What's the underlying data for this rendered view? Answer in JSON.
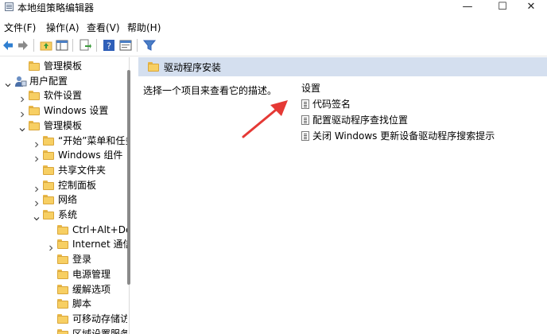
{
  "window": {
    "title": "本地组策略编辑器",
    "minimize": "—",
    "maximize": "☐",
    "close": "✕"
  },
  "menu": {
    "file": "文件(F)",
    "action": "操作(A)",
    "view": "查看(V)",
    "help": "帮助(H)"
  },
  "toolbar": {
    "buttons": [
      "back-icon",
      "forward-icon",
      "up-folder-icon",
      "show-hide-tree-icon",
      "export-list-icon",
      "help-icon",
      "properties-icon",
      "filter-icon"
    ]
  },
  "tree": {
    "items": [
      {
        "label": "管理模板",
        "depth": 1,
        "expanded": null,
        "icon": "folder"
      },
      {
        "label": "用户配置",
        "depth": 0,
        "expanded": true,
        "icon": "user"
      },
      {
        "label": "软件设置",
        "depth": 1,
        "expanded": false,
        "icon": "folder"
      },
      {
        "label": "Windows 设置",
        "depth": 1,
        "expanded": false,
        "icon": "folder"
      },
      {
        "label": "管理模板",
        "depth": 1,
        "expanded": true,
        "icon": "folder"
      },
      {
        "label": "“开始”菜单和任务",
        "depth": 2,
        "expanded": false,
        "icon": "folder"
      },
      {
        "label": "Windows 组件",
        "depth": 2,
        "expanded": false,
        "icon": "folder"
      },
      {
        "label": "共享文件夹",
        "depth": 2,
        "expanded": null,
        "icon": "folder"
      },
      {
        "label": "控制面板",
        "depth": 2,
        "expanded": false,
        "icon": "folder"
      },
      {
        "label": "网络",
        "depth": 2,
        "expanded": false,
        "icon": "folder"
      },
      {
        "label": "系统",
        "depth": 2,
        "expanded": true,
        "icon": "folder"
      },
      {
        "label": "Ctrl+Alt+De",
        "depth": 3,
        "expanded": null,
        "icon": "folder"
      },
      {
        "label": "Internet 通信",
        "depth": 3,
        "expanded": false,
        "icon": "folder"
      },
      {
        "label": "登录",
        "depth": 3,
        "expanded": null,
        "icon": "folder"
      },
      {
        "label": "电源管理",
        "depth": 3,
        "expanded": null,
        "icon": "folder"
      },
      {
        "label": "缓解选项",
        "depth": 3,
        "expanded": null,
        "icon": "folder"
      },
      {
        "label": "脚本",
        "depth": 3,
        "expanded": null,
        "icon": "folder"
      },
      {
        "label": "可移动存储访",
        "depth": 3,
        "expanded": null,
        "icon": "folder"
      },
      {
        "label": "区域设置服务",
        "depth": 3,
        "expanded": null,
        "icon": "folder"
      }
    ]
  },
  "details": {
    "header": "驱动程序安装",
    "description": "选择一个项目来查看它的描述。",
    "settings_heading": "设置",
    "settings": [
      "代码签名",
      "配置驱动程序查找位置",
      "关闭 Windows 更新设备驱动程序搜索提示"
    ]
  },
  "colors": {
    "header_bg": "#d4dfef",
    "arrow": "#e53935",
    "folder": "#f7cf63"
  }
}
